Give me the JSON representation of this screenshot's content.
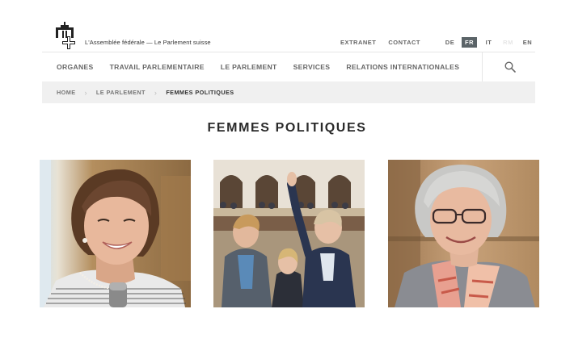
{
  "brand": {
    "text": "L'Assemblée fédérale — Le Parlement suisse"
  },
  "toplinks": [
    {
      "label": "EXTRANET"
    },
    {
      "label": "CONTACT"
    }
  ],
  "languages": [
    {
      "label": "DE",
      "active": false
    },
    {
      "label": "FR",
      "active": true
    },
    {
      "label": "IT",
      "active": false
    },
    {
      "label": "RM",
      "active": false
    },
    {
      "label": "EN",
      "active": false
    }
  ],
  "nav": {
    "items": [
      {
        "label": "ORGANES"
      },
      {
        "label": "TRAVAIL PARLEMENTAIRE"
      },
      {
        "label": "LE PARLEMENT"
      },
      {
        "label": "SERVICES"
      },
      {
        "label": "RELATIONS INTERNATIONALES"
      }
    ],
    "search_icon": "search-icon"
  },
  "breadcrumb": {
    "items": [
      "HOME",
      "LE PARLEMENT",
      "FEMMES POLITIQUES"
    ]
  },
  "page": {
    "title": "FEMMES POLITIQUES"
  },
  "colors": {
    "active_lang_bg": "#5b6468",
    "breadcrumb_bg": "#f0f0f0",
    "nav_text": "#666666"
  }
}
